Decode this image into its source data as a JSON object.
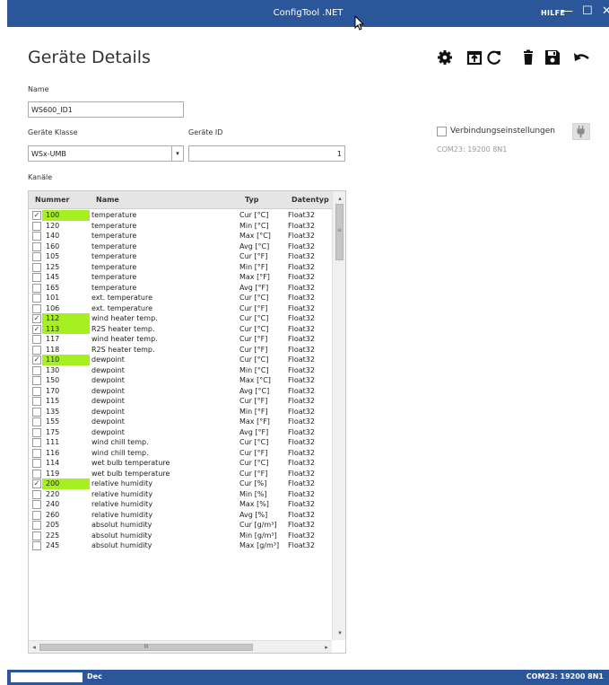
{
  "window": {
    "title": "ConfigTool .NET",
    "help_label": "HILFE",
    "minimize_glyph": "—",
    "maximize_glyph": "☐",
    "close_glyph": "✕"
  },
  "page": {
    "title": "Geräte Details"
  },
  "toolbar": {
    "icons": [
      "gear-icon",
      "export-icon",
      "refresh-icon",
      "delete-icon",
      "save-icon",
      "undo-icon"
    ]
  },
  "form": {
    "name_label": "Name",
    "name_value": "WS600_ID1",
    "device_class_label": "Geräte Klasse",
    "device_class_value": "WSx-UMB",
    "device_id_label": "Geräte ID",
    "device_id_value": "1",
    "channels_label": "Kanäle"
  },
  "connection": {
    "settings_label": "Verbindungseinstellungen",
    "status_text": "COM23: 19200 8N1",
    "checked": false
  },
  "grid": {
    "headers": {
      "number": "Nummer",
      "name": "Name",
      "type": "Typ",
      "datatype": "Datentyp"
    },
    "rows": [
      {
        "checked": "✓",
        "number": "100",
        "name": "temperature",
        "type": "Cur [°C]",
        "datatype": "Float32",
        "highlight": true
      },
      {
        "checked": "",
        "number": "120",
        "name": "temperature",
        "type": "Min [°C]",
        "datatype": "Float32",
        "highlight": false
      },
      {
        "checked": "",
        "number": "140",
        "name": "temperature",
        "type": "Max [°C]",
        "datatype": "Float32",
        "highlight": false
      },
      {
        "checked": "",
        "number": "160",
        "name": "temperature",
        "type": "Avg [°C]",
        "datatype": "Float32",
        "highlight": false
      },
      {
        "checked": "",
        "number": "105",
        "name": "temperature",
        "type": "Cur [°F]",
        "datatype": "Float32",
        "highlight": false
      },
      {
        "checked": "",
        "number": "125",
        "name": "temperature",
        "type": "Min [°F]",
        "datatype": "Float32",
        "highlight": false
      },
      {
        "checked": "",
        "number": "145",
        "name": "temperature",
        "type": "Max [°F]",
        "datatype": "Float32",
        "highlight": false
      },
      {
        "checked": "",
        "number": "165",
        "name": "temperature",
        "type": "Avg [°F]",
        "datatype": "Float32",
        "highlight": false
      },
      {
        "checked": "",
        "number": "101",
        "name": "ext. temperature",
        "type": "Cur [°C]",
        "datatype": "Float32",
        "highlight": false
      },
      {
        "checked": "",
        "number": "106",
        "name": "ext. temperature",
        "type": "Cur [°F]",
        "datatype": "Float32",
        "highlight": false
      },
      {
        "checked": "✓",
        "number": "112",
        "name": "wind heater temp.",
        "type": "Cur [°C]",
        "datatype": "Float32",
        "highlight": true
      },
      {
        "checked": "✓",
        "number": "113",
        "name": "R2S heater temp.",
        "type": "Cur [°C]",
        "datatype": "Float32",
        "highlight": true
      },
      {
        "checked": "",
        "number": "117",
        "name": "wind heater temp.",
        "type": "Cur [°F]",
        "datatype": "Float32",
        "highlight": false
      },
      {
        "checked": "",
        "number": "118",
        "name": "R2S heater temp.",
        "type": "Cur [°F]",
        "datatype": "Float32",
        "highlight": false
      },
      {
        "checked": "✓",
        "number": "110",
        "name": "dewpoint",
        "type": "Cur [°C]",
        "datatype": "Float32",
        "highlight": true
      },
      {
        "checked": "",
        "number": "130",
        "name": "dewpoint",
        "type": "Min [°C]",
        "datatype": "Float32",
        "highlight": false
      },
      {
        "checked": "",
        "number": "150",
        "name": "dewpoint",
        "type": "Max [°C]",
        "datatype": "Float32",
        "highlight": false
      },
      {
        "checked": "",
        "number": "170",
        "name": "dewpoint",
        "type": "Avg [°C]",
        "datatype": "Float32",
        "highlight": false
      },
      {
        "checked": "",
        "number": "115",
        "name": "dewpoint",
        "type": "Cur [°F]",
        "datatype": "Float32",
        "highlight": false
      },
      {
        "checked": "",
        "number": "135",
        "name": "dewpoint",
        "type": "Min [°F]",
        "datatype": "Float32",
        "highlight": false
      },
      {
        "checked": "",
        "number": "155",
        "name": "dewpoint",
        "type": "Max [°F]",
        "datatype": "Float32",
        "highlight": false
      },
      {
        "checked": "",
        "number": "175",
        "name": "dewpoint",
        "type": "Avg [°F]",
        "datatype": "Float32",
        "highlight": false
      },
      {
        "checked": "",
        "number": "111",
        "name": "wind chill temp.",
        "type": "Cur [°C]",
        "datatype": "Float32",
        "highlight": false
      },
      {
        "checked": "",
        "number": "116",
        "name": "wind chill temp.",
        "type": "Cur [°F]",
        "datatype": "Float32",
        "highlight": false
      },
      {
        "checked": "",
        "number": "114",
        "name": "wet bulb temperature",
        "type": "Cur [°C]",
        "datatype": "Float32",
        "highlight": false
      },
      {
        "checked": "",
        "number": "119",
        "name": "wet bulb temperature",
        "type": "Cur [°F]",
        "datatype": "Float32",
        "highlight": false
      },
      {
        "checked": "✓",
        "number": "200",
        "name": "relative humidity",
        "type": "Cur [%]",
        "datatype": "Float32",
        "highlight": true
      },
      {
        "checked": "",
        "number": "220",
        "name": "relative humidity",
        "type": "Min [%]",
        "datatype": "Float32",
        "highlight": false
      },
      {
        "checked": "",
        "number": "240",
        "name": "relative humidity",
        "type": "Max [%]",
        "datatype": "Float32",
        "highlight": false
      },
      {
        "checked": "",
        "number": "260",
        "name": "relative humidity",
        "type": "Avg [%]",
        "datatype": "Float32",
        "highlight": false
      },
      {
        "checked": "",
        "number": "205",
        "name": "absolut humidity",
        "type": "Cur [g/m³]",
        "datatype": "Float32",
        "highlight": false
      },
      {
        "checked": "",
        "number": "225",
        "name": "absolut humidity",
        "type": "Min [g/m³]",
        "datatype": "Float32",
        "highlight": false
      },
      {
        "checked": "",
        "number": "245",
        "name": "absolut humidity",
        "type": "Max [g/m³]",
        "datatype": "Float32",
        "highlight": false
      }
    ],
    "scroll_up": "▴",
    "scroll_down": "▾",
    "scroll_grip": "≡",
    "scroll_left": "◂",
    "scroll_right": "▸",
    "hscroll_grip": "III"
  },
  "statusbar": {
    "format": "Dec",
    "port": "COM23: 19200 8N1"
  },
  "colors": {
    "accent": "#2b579a",
    "highlight": "#a6f022"
  }
}
